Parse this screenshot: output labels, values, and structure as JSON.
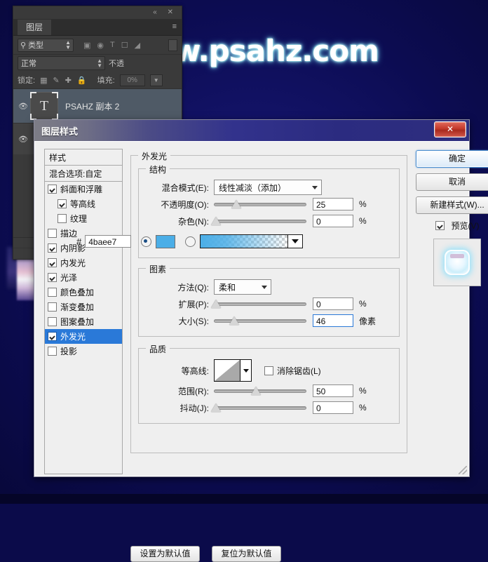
{
  "watermark": {
    "text": "www.psahz.com"
  },
  "layers_panel": {
    "topbar": {
      "collapse_icon": "«",
      "close_icon": "✕"
    },
    "tab_label": "图层",
    "menu_icon": "≡",
    "filter": {
      "search_icon": "search-icon",
      "kind_label": "类型",
      "icons": [
        "image-filter-icon",
        "adjustment-filter-icon",
        "type-filter-icon",
        "shape-filter-icon",
        "smartobject-filter-icon"
      ]
    },
    "blend_mode": "正常",
    "opacity_label": "不透",
    "lock_label": "锁定:",
    "lock_icons": [
      "transparency-lock-icon",
      "paint-lock-icon",
      "move-lock-icon",
      "all-lock-icon"
    ],
    "fill_label": "填充:",
    "fill_value": "0%",
    "layer": {
      "visibility_icon": "eye-icon",
      "thumb_glyph": "T",
      "name": "PSAHZ 副本 2"
    }
  },
  "dialog": {
    "title": "图层样式",
    "close_label": "✕",
    "styles_header": "样式",
    "blending_options": "混合选项:自定",
    "effects": [
      {
        "label": "斜面和浮雕",
        "checked": true,
        "indent": false,
        "active": false
      },
      {
        "label": "等高线",
        "checked": true,
        "indent": true,
        "active": false
      },
      {
        "label": "纹理",
        "checked": false,
        "indent": true,
        "active": false
      },
      {
        "label": "描边",
        "checked": false,
        "indent": false,
        "active": false
      },
      {
        "label": "内阴影",
        "checked": true,
        "indent": false,
        "active": false
      },
      {
        "label": "内发光",
        "checked": true,
        "indent": false,
        "active": false
      },
      {
        "label": "光泽",
        "checked": true,
        "indent": false,
        "active": false
      },
      {
        "label": "颜色叠加",
        "checked": false,
        "indent": false,
        "active": false
      },
      {
        "label": "渐变叠加",
        "checked": false,
        "indent": false,
        "active": false
      },
      {
        "label": "图案叠加",
        "checked": false,
        "indent": false,
        "active": false
      },
      {
        "label": "外发光",
        "checked": true,
        "indent": false,
        "active": true
      },
      {
        "label": "投影",
        "checked": false,
        "indent": false,
        "active": false
      }
    ],
    "panel": {
      "title": "外发光",
      "structure": {
        "legend": "结构",
        "blend_mode_label": "混合模式(E):",
        "blend_mode_value": "线性减淡（添加）",
        "opacity_label": "不透明度(O):",
        "opacity_value": "25",
        "opacity_unit": "%",
        "noise_label": "杂色(N):",
        "noise_value": "0",
        "noise_unit": "%",
        "hash": "#",
        "color_hex": "4baee7",
        "color_swatch": "#4baee7",
        "color_mode": "solid"
      },
      "elements": {
        "legend": "图素",
        "technique_label": "方法(Q):",
        "technique_value": "柔和",
        "spread_label": "扩展(P):",
        "spread_value": "0",
        "spread_unit": "%",
        "size_label": "大小(S):",
        "size_value": "46",
        "size_unit": "像素"
      },
      "quality": {
        "legend": "品质",
        "contour_label": "等高线:",
        "antialias_label": "消除锯齿(L)",
        "antialias_checked": false,
        "range_label": "范围(R):",
        "range_value": "50",
        "range_unit": "%",
        "jitter_label": "抖动(J):",
        "jitter_value": "0",
        "jitter_unit": "%"
      }
    },
    "bottom_buttons": {
      "set_default": "设置为默认值",
      "reset_default": "复位为默认值"
    },
    "right": {
      "ok": "确定",
      "cancel": "取消",
      "new_style": "新建样式(W)...",
      "preview_label": "预览(V)",
      "preview_checked": true
    }
  }
}
